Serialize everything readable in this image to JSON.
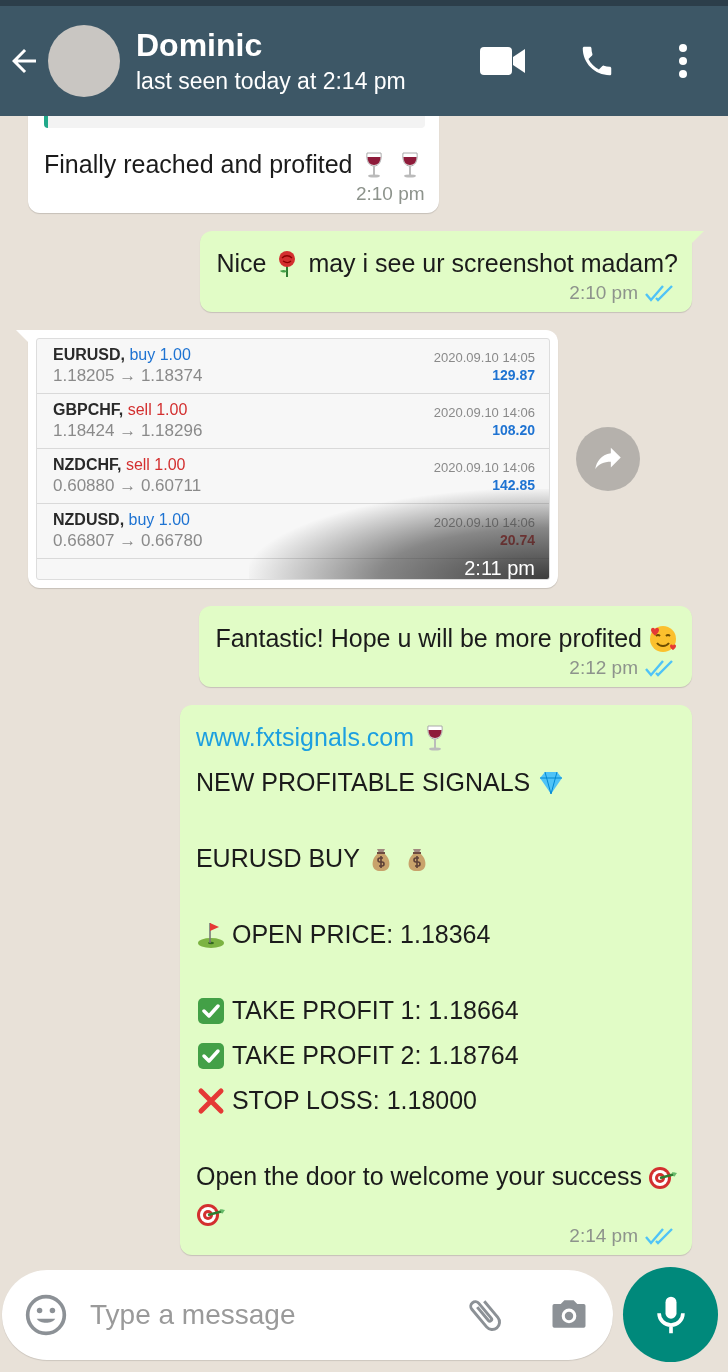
{
  "header": {
    "name": "Dominic",
    "status": "last seen today at 2:14 pm"
  },
  "messages": [
    {
      "kind": "text",
      "outgoing": false,
      "quoted": true,
      "time": "2:10 pm",
      "paragraphs": [
        [
          [
            {
              "kind": "text",
              "text": "Finally reached and profited"
            },
            {
              "kind": "wine"
            },
            {
              "kind": "wine"
            }
          ]
        ]
      ]
    },
    {
      "kind": "text",
      "outgoing": true,
      "tail": true,
      "read": true,
      "time": "2:10 pm",
      "paragraphs": [
        [
          [
            {
              "kind": "text",
              "text": "Nice"
            },
            {
              "kind": "rose"
            },
            {
              "kind": "text",
              "text": "may i see ur screenshot madam?"
            }
          ]
        ]
      ]
    },
    {
      "kind": "image",
      "outgoing": false,
      "tail": true,
      "time": "2:11 pm",
      "rows": [
        {
          "symbol": "EURUSD,",
          "side": "buy 1.00",
          "kind": "buy",
          "prices": "1.18205 → 1.18374",
          "date": "2020.09.10 14:05",
          "profit": "129.87",
          "loss": false
        },
        {
          "symbol": "GBPCHF,",
          "side": "sell 1.00",
          "kind": "sell",
          "prices": "1.18424 → 1.18296",
          "date": "2020.09.10 14:06",
          "profit": "108.20",
          "loss": false
        },
        {
          "symbol": "NZDCHF,",
          "side": "sell 1.00",
          "kind": "sell",
          "prices": "0.60880 → 0.60711",
          "date": "2020.09.10 14:06",
          "profit": "142.85",
          "loss": false
        },
        {
          "symbol": "NZDUSD,",
          "side": "buy 1.00",
          "kind": "buy",
          "prices": "0.66807 → 0.66780",
          "date": "2020.09.10 14:06",
          "profit": "20.74",
          "loss": true
        }
      ]
    },
    {
      "kind": "text",
      "outgoing": true,
      "read": true,
      "time": "2:12 pm",
      "paragraphs": [
        [
          [
            {
              "kind": "text",
              "text": "Fantastic! Hope u will be more profited"
            },
            {
              "kind": "smiling-face"
            }
          ]
        ]
      ]
    },
    {
      "kind": "text",
      "outgoing": true,
      "read": true,
      "time": "2:14 pm",
      "paragraphs": [
        [
          [
            {
              "kind": "link",
              "text": "www.fxtsignals.com"
            },
            {
              "kind": "wine"
            }
          ],
          [
            {
              "kind": "text",
              "text": "NEW PROFITABLE SIGNALS"
            },
            {
              "kind": "gem"
            }
          ]
        ],
        [
          [
            {
              "kind": "text",
              "text": "EURUSD BUY"
            },
            {
              "kind": "money-bag"
            },
            {
              "kind": "money-bag"
            }
          ]
        ],
        [
          [
            {
              "kind": "golf-flag"
            },
            {
              "kind": "text",
              "text": "OPEN PRICE: 1.18364"
            }
          ]
        ],
        [
          [
            {
              "kind": "check"
            },
            {
              "kind": "text",
              "text": "TAKE PROFIT 1: 1.18664"
            }
          ],
          [
            {
              "kind": "check"
            },
            {
              "kind": "text",
              "text": "TAKE PROFIT 2: 1.18764"
            }
          ],
          [
            {
              "kind": "cross"
            },
            {
              "kind": "text",
              "text": "STOP LOSS: 1.18000"
            }
          ]
        ],
        [
          [
            {
              "kind": "text",
              "text": "Open the door to welcome your success"
            },
            {
              "kind": "target"
            }
          ],
          [
            {
              "kind": "target"
            }
          ]
        ]
      ]
    }
  ],
  "composer": {
    "placeholder": "Type a message"
  }
}
